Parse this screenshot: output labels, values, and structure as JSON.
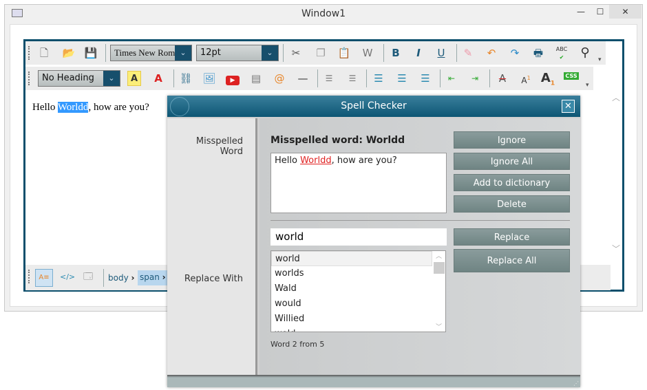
{
  "window": {
    "title": "Window1",
    "minimize": "—",
    "maximize": "☐",
    "close": "✕"
  },
  "toolbar": {
    "font_name": "Times New Roman",
    "font_size": "12pt",
    "heading": "No Heading",
    "bold": "B",
    "italic": "I",
    "underline": "U",
    "highlight": "A",
    "font_color": "A",
    "spell": "ABC"
  },
  "editor": {
    "text_before": "Hello ",
    "text_selected": "Worldd",
    "text_after": ", how are you?"
  },
  "statusbar": {
    "breadcrumbs": [
      "body",
      "span"
    ],
    "code_view": "</>"
  },
  "dialog": {
    "title": "Spell Checker",
    "misspelled_label": "Misspelled Word",
    "misspelled_heading": "Misspelled word: Worldd",
    "context_before": "Hello ",
    "context_word": "Worldd",
    "context_after": ", how are you?",
    "replace_label": "Replace With",
    "replace_value": "world",
    "suggestions": [
      "world",
      "worlds",
      "Wald",
      "would",
      "Willied",
      "wold"
    ],
    "progress": "Word 2 from 5",
    "buttons": {
      "ignore": "Ignore",
      "ignore_all": "Ignore All",
      "add": "Add to dictionary",
      "delete": "Delete",
      "replace": "Replace",
      "replace_all": "Replace All"
    }
  },
  "colors": {
    "accent": "#0b4f6c",
    "selection": "#3399ff",
    "button": "#7b8f8e",
    "misspelled": "#e02020"
  }
}
